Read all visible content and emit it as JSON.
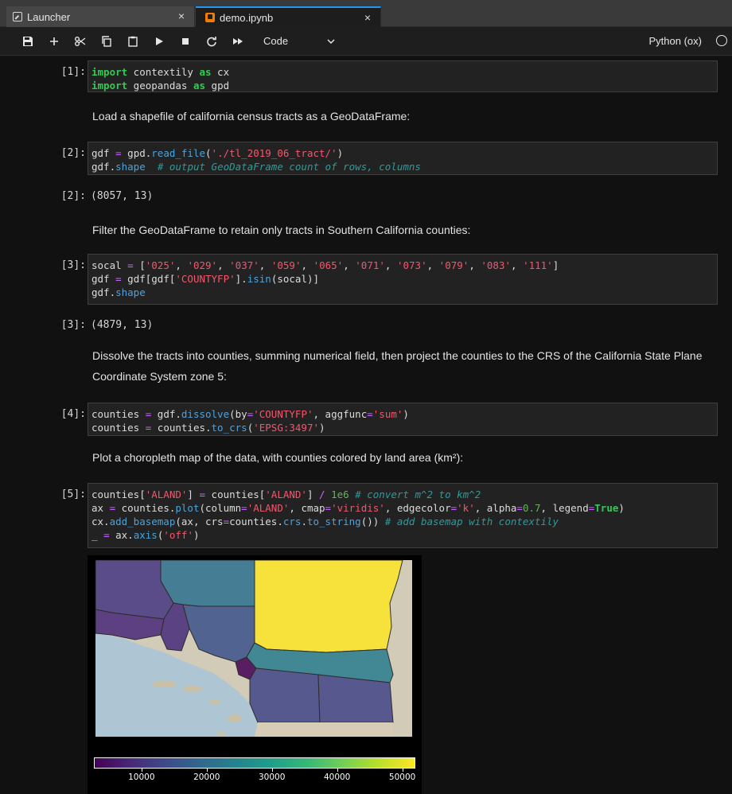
{
  "tabs": [
    {
      "label": "Launcher",
      "close": "×"
    },
    {
      "label": "demo.ipynb",
      "close": "×"
    }
  ],
  "toolbar": {
    "cell_type": "Code",
    "kernel_name": "Python (ox)"
  },
  "cells": [
    {
      "prompt": "[1]:"
    },
    {
      "markdown": "Load a shapefile of california census tracts as a GeoDataFrame:"
    },
    {
      "prompt": "[2]:"
    },
    {
      "output_prompt": "[2]:",
      "output": "(8057, 13)"
    },
    {
      "markdown": "Filter the GeoDataFrame to retain only tracts in Southern California counties:"
    },
    {
      "prompt": "[3]:"
    },
    {
      "output_prompt": "[3]:",
      "output": "(4879, 13)"
    },
    {
      "markdown": "Dissolve the tracts into counties, summing numerical field, then project the counties to the CRS of the California State Plane Coordinate System zone 5:"
    },
    {
      "prompt": "[4]:"
    },
    {
      "markdown": "Plot a choropleth map of the data, with counties colored by land area (km²):"
    },
    {
      "prompt": "[5]:"
    }
  ],
  "colorbar": {
    "labels": [
      "10000",
      "20000",
      "30000",
      "40000",
      "50000"
    ],
    "min": 2700,
    "max": 52000,
    "cmap": "viridis"
  },
  "colors": {
    "accent": "#2196f3",
    "keyword": "#2ecc52",
    "string": "#f4566c",
    "function": "#4aa3df",
    "operator": "#c767ff",
    "comment": "#2e9b9b"
  }
}
